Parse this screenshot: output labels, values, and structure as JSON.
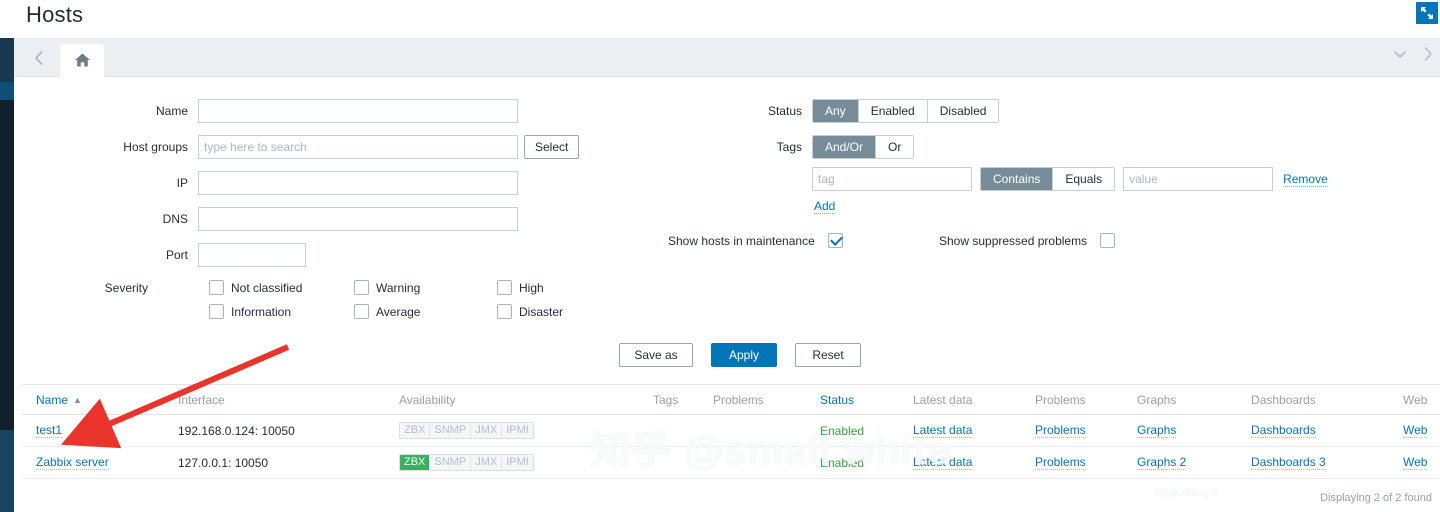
{
  "header": {
    "title": "Hosts",
    "kiosk_icon": "expand-arrows-icon"
  },
  "tabbar": {
    "back_icon": "chevron-left-icon",
    "home_icon": "home-icon",
    "collapse_icon": "chevron-down-icon",
    "next_icon": "chevron-right-icon"
  },
  "filter": {
    "fields": {
      "name_label": "Name",
      "name_value": "",
      "host_groups_label": "Host groups",
      "host_groups_value": "",
      "host_groups_placeholder": "type here to search",
      "select_button": "Select",
      "ip_label": "IP",
      "ip_value": "",
      "dns_label": "DNS",
      "dns_value": "",
      "port_label": "Port",
      "port_value": "",
      "severity_label": "Severity"
    },
    "severity": [
      {
        "label": "Not classified",
        "checked": false
      },
      {
        "label": "Warning",
        "checked": false
      },
      {
        "label": "High",
        "checked": false
      },
      {
        "label": "Information",
        "checked": false
      },
      {
        "label": "Average",
        "checked": false
      },
      {
        "label": "Disaster",
        "checked": false
      }
    ],
    "status": {
      "label": "Status",
      "options": [
        "Any",
        "Enabled",
        "Disabled"
      ],
      "selected": "Any"
    },
    "tags": {
      "label": "Tags",
      "operator_options": [
        "And/Or",
        "Or"
      ],
      "operator_selected": "And/Or",
      "tag_placeholder": "tag",
      "tag_value": "",
      "match_options": [
        "Contains",
        "Equals"
      ],
      "match_selected": "Contains",
      "value_placeholder": "value",
      "value_value": "",
      "remove_label": "Remove",
      "add_label": "Add"
    },
    "toggles": {
      "maintenance_label": "Show hosts in maintenance",
      "maintenance_checked": true,
      "suppressed_label": "Show suppressed problems",
      "suppressed_checked": false
    },
    "buttons": {
      "save_as": "Save as",
      "apply": "Apply",
      "reset": "Reset"
    }
  },
  "table": {
    "columns": {
      "name": "Name",
      "sort_icon": "▲",
      "interface": "Interface",
      "availability": "Availability",
      "tags": "Tags",
      "problems": "Problems",
      "status": "Status",
      "latest_data": "Latest data",
      "problems2": "Problems",
      "graphs": "Graphs",
      "dashboards": "Dashboards",
      "web": "Web"
    },
    "rows": [
      {
        "name": "test1",
        "interface": "192.168.0.124: 10050",
        "availability": [
          {
            "label": "ZBX",
            "state": "unknown"
          },
          {
            "label": "SNMP",
            "state": "unknown"
          },
          {
            "label": "JMX",
            "state": "unknown"
          },
          {
            "label": "IPMI",
            "state": "unknown"
          }
        ],
        "tags": "",
        "problems": "",
        "status": "Enabled",
        "latest_data": "Latest data",
        "problems2": "Problems",
        "graphs": "Graphs",
        "dashboards": "Dashboards",
        "web": "Web"
      },
      {
        "name": "Zabbix server",
        "interface": "127.0.0.1: 10050",
        "availability": [
          {
            "label": "ZBX",
            "state": "ok"
          },
          {
            "label": "SNMP",
            "state": "unknown"
          },
          {
            "label": "JMX",
            "state": "unknown"
          },
          {
            "label": "IPMI",
            "state": "unknown"
          }
        ],
        "tags": "",
        "problems": "",
        "status": "Enabled",
        "latest_data": "Latest data",
        "problems2": "Problems",
        "graphs": "Graphs 2",
        "dashboards": "Dashboards 3",
        "web": "Web"
      }
    ],
    "footer_count": "Displaying 2 of 2 found"
  },
  "watermark": {
    "main": "知乎 @small white",
    "sub": "https://blog.c"
  },
  "colors": {
    "accent": "#0275b8",
    "segment_selected": "#768d99",
    "status_enabled": "#3ba23b",
    "availability_ok": "#33b25f",
    "rail": "#1f3a4d",
    "annotation_arrow": "#e8342a"
  }
}
